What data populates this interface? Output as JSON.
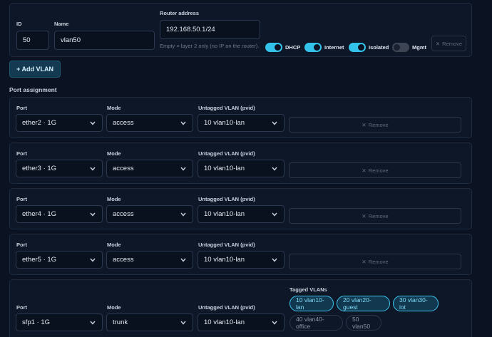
{
  "vlan_form": {
    "id_label": "ID",
    "id_value": "50",
    "name_label": "Name",
    "name_value": "vlan50",
    "router_label": "Router address",
    "router_value": "192.168.50.1/24",
    "router_hint": "Empty = layer 2 only (no IP on the router).",
    "toggles": [
      {
        "label": "DHCP",
        "on": true
      },
      {
        "label": "Internet",
        "on": true
      },
      {
        "label": "Isolated",
        "on": true
      },
      {
        "label": "Mgmt",
        "on": false
      }
    ],
    "remove_label": "Remove"
  },
  "add_vlan_label": "+ Add VLAN",
  "port_assignment": {
    "title": "Port assignment",
    "col_port": "Port",
    "col_mode": "Mode",
    "col_pvid": "Untagged VLAN (pvid)",
    "col_tagged": "Tagged VLANs",
    "remove_label": "Remove",
    "rows": [
      {
        "port": "ether2 · 1G",
        "mode": "access",
        "pvid": "10 vlan10-lan"
      },
      {
        "port": "ether3 · 1G",
        "mode": "access",
        "pvid": "10 vlan10-lan"
      },
      {
        "port": "ether4 · 1G",
        "mode": "access",
        "pvid": "10 vlan10-lan"
      },
      {
        "port": "ether5 · 1G",
        "mode": "access",
        "pvid": "10 vlan10-lan"
      },
      {
        "port": "sfp1 · 1G",
        "mode": "trunk",
        "pvid": "10 vlan10-lan"
      }
    ],
    "tagged_vlans": [
      {
        "label": "10 vlan10-lan",
        "selected": true
      },
      {
        "label": "20 vlan20-guest",
        "selected": true
      },
      {
        "label": "30 vlan30-iot",
        "selected": true
      },
      {
        "label": "40 vlan40-office",
        "selected": false
      },
      {
        "label": "50 vlan50",
        "selected": false
      }
    ]
  },
  "colors": {
    "background": "#0b1322",
    "accent": "#33c3ea",
    "card": "#0e1728"
  },
  "icons": {
    "select_arrow": "chevron-down-icon",
    "remove": "close-icon"
  }
}
